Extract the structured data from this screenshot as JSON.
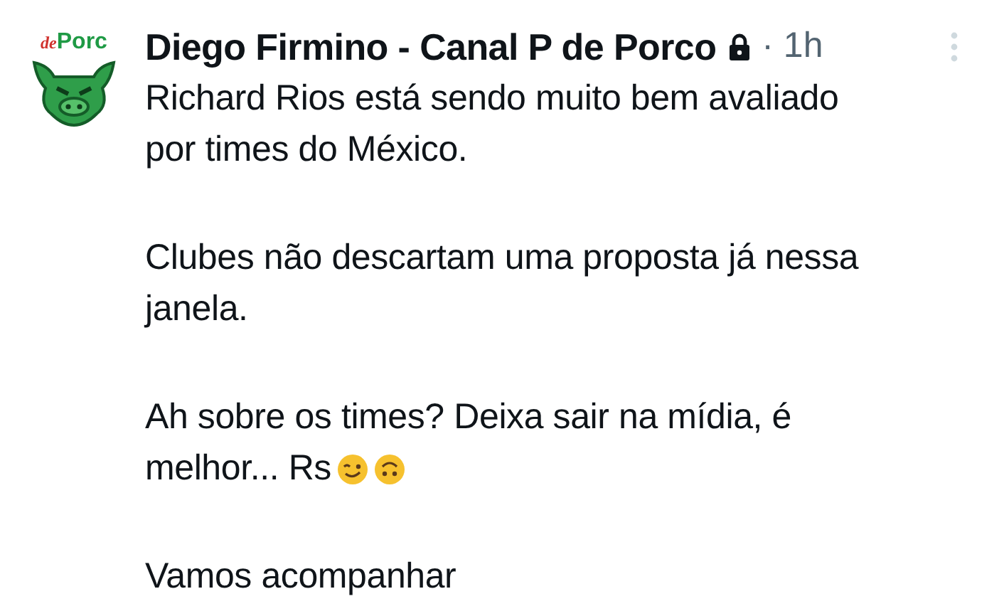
{
  "avatar": {
    "logo_words": [
      "de",
      "Porc"
    ]
  },
  "author": {
    "name": "Diego Firmino - Canal P de Porco",
    "locked": true,
    "time": "· 1h"
  },
  "paragraphs": [
    {
      "lines": [
        "Richard Rios está sendo muito bem avaliado",
        "por times do México."
      ]
    },
    {
      "lines": [
        "Clubes não descartam uma proposta já nessa",
        "janela."
      ]
    },
    {
      "lines": [
        "Ah sobre os times? Deixa sair na mídia, é",
        "melhor... Rs"
      ],
      "emoji": [
        {
          "kind": "wink"
        },
        {
          "kind": "upside-down"
        }
      ]
    },
    {
      "lines": [
        "Vamos acompanhar"
      ]
    }
  ]
}
